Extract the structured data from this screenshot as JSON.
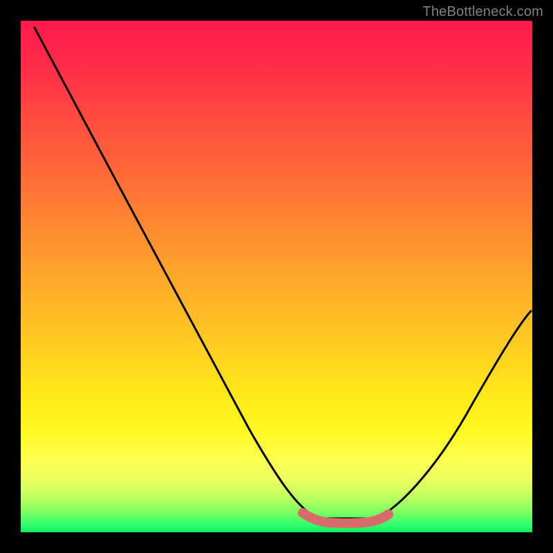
{
  "watermark": "TheBottleneck.com",
  "chart_data": {
    "type": "line",
    "title": "",
    "xlabel": "",
    "ylabel": "",
    "xlim": [
      0,
      100
    ],
    "ylim": [
      0,
      100
    ],
    "x": [
      0,
      10,
      20,
      30,
      40,
      50,
      55,
      60,
      65,
      70,
      80,
      90,
      100
    ],
    "values": [
      100,
      85,
      70,
      55,
      38,
      20,
      10,
      3,
      1,
      1,
      6,
      20,
      42
    ],
    "series": [
      {
        "name": "curve",
        "color": "#000000",
        "x": [
          0,
          10,
          20,
          30,
          40,
          50,
          55,
          60,
          65,
          70,
          80,
          90,
          100
        ],
        "y": [
          100,
          85,
          70,
          55,
          38,
          20,
          10,
          3,
          1,
          1,
          6,
          20,
          42
        ]
      },
      {
        "name": "highlight",
        "color": "#d96b6b",
        "x": [
          56,
          58,
          60,
          62,
          64,
          66,
          68,
          70,
          72,
          74
        ],
        "y": [
          2.5,
          1.5,
          1,
          1,
          1,
          1,
          1,
          1.5,
          2,
          3
        ]
      }
    ],
    "background_gradient": {
      "top": "#ff1a4d",
      "middle": "#ffd120",
      "bottom": "#10ee60"
    }
  }
}
